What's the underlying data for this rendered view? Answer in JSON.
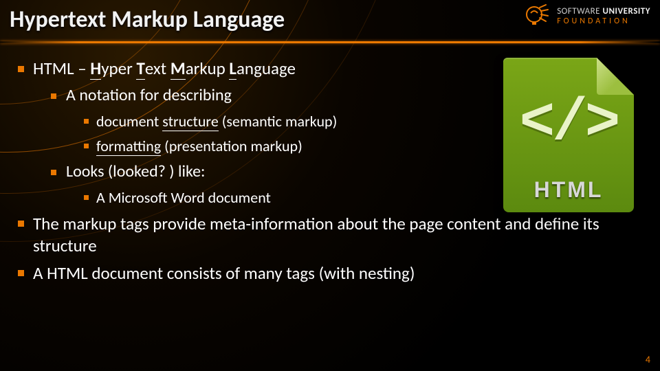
{
  "title": "Hypertext Markup Language",
  "logo": {
    "line1": "SOFTWARE",
    "line2": "UNIVERSITY",
    "line3": "FOUNDATION"
  },
  "bullets": {
    "b1_pre": "HTML – ",
    "b1_h": "H",
    "b1_ht": "yper ",
    "b1_t": "T",
    "b1_tt": "ext ",
    "b1_m": "M",
    "b1_mt": "arkup ",
    "b1_l": "L",
    "b1_lt": "anguage",
    "b1a": "A notation for describing",
    "b1a1_pre": "document ",
    "b1a1_u": "structure",
    "b1a1_post": " (semantic markup)",
    "b1a2_u": "formatting",
    "b1a2_post": " (presentation markup)",
    "b1b": "Looks (looked? ) like:",
    "b1b1": "A Microsoft Word document",
    "b2": "The markup tags provide meta-information about the page content and define its structure",
    "b3": "A HTML document consists of many tags (with nesting)"
  },
  "icon": {
    "tag": "</>",
    "label": "HTML"
  },
  "page_number": "4"
}
